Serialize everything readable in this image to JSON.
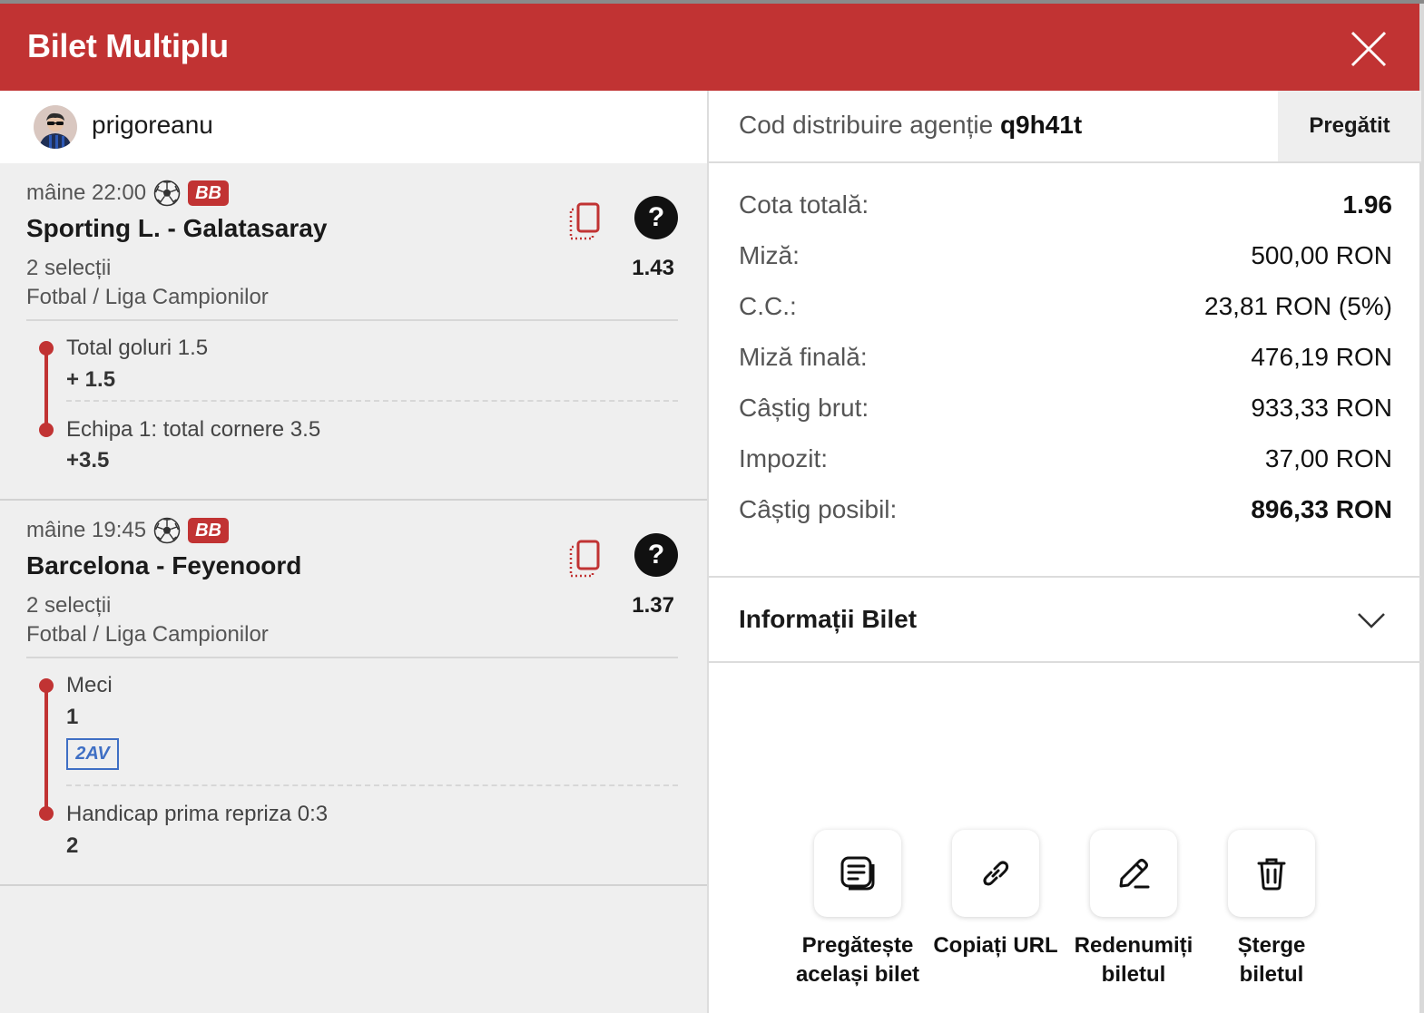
{
  "header": {
    "title": "Bilet Multiplu"
  },
  "user": {
    "name": "prigoreanu"
  },
  "events": [
    {
      "time": "mâine 22:00",
      "badge": "BB",
      "name": "Sporting L. - Galatasaray",
      "selections": "2 selecții",
      "odd": "1.43",
      "league": "Fotbal / Liga Campionilor",
      "markets": [
        {
          "name": "Total goluri 1.5",
          "value": "+ 1.5"
        },
        {
          "name": "Echipa 1: total cornere 3.5",
          "value": "+3.5"
        }
      ]
    },
    {
      "time": "mâine 19:45",
      "badge": "BB",
      "name": "Barcelona - Feyenoord",
      "selections": "2 selecții",
      "odd": "1.37",
      "league": "Fotbal / Liga Campionilor",
      "markets": [
        {
          "name": "Meci",
          "value": "1",
          "tag": "2AV"
        },
        {
          "name": "Handicap prima repriza 0:3",
          "value": "2"
        }
      ]
    }
  ],
  "code": {
    "label": "Cod distribuire agenție",
    "value": "q9h41t",
    "button": "Pregătit"
  },
  "summary": [
    {
      "label": "Cota totală:",
      "value": "1.96"
    },
    {
      "label": "Miză:",
      "value": "500,00 RON"
    },
    {
      "label": "C.C.:",
      "value": "23,81 RON (5%)"
    },
    {
      "label": "Miză finală:",
      "value": "476,19 RON"
    },
    {
      "label": "Câștig brut:",
      "value": "933,33 RON"
    },
    {
      "label": "Impozit:",
      "value": "37,00 RON"
    },
    {
      "label": "Câștig posibil:",
      "value": "896,33 RON"
    }
  ],
  "info": {
    "label": "Informații Bilet"
  },
  "actions": [
    {
      "label": "Pregătește\nacelași bilet",
      "icon": "ticket-list-icon"
    },
    {
      "label": "Copiați URL",
      "icon": "link-icon"
    },
    {
      "label": "Redenumiți\nbiletul",
      "icon": "pencil-icon"
    },
    {
      "label": "Șterge\nbiletul",
      "icon": "trash-icon"
    }
  ],
  "colors": {
    "brand": "#c13333",
    "tag": "#3f6fc4"
  }
}
